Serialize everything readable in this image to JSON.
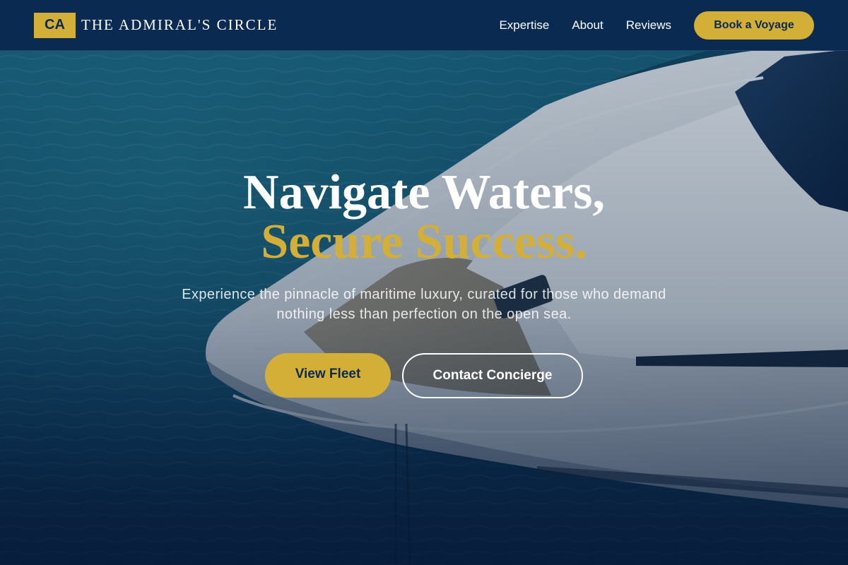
{
  "brand": {
    "logo_mark": "CA",
    "name": "THE ADMIRAL'S CIRCLE"
  },
  "nav": {
    "links": [
      "Expertise",
      "About",
      "Reviews"
    ],
    "cta": "Book a Voyage"
  },
  "hero": {
    "headline_line1": "Navigate Waters,",
    "headline_line2": "Secure Success.",
    "subtext_line1": "Experience the pinnacle of maritime luxury, curated for those who demand",
    "subtext_line2": "nothing less than perfection on the open sea.",
    "primary_button": "View Fleet",
    "secondary_button": "Contact Concierge",
    "background_image": "luxury-yacht-aerial-photo"
  },
  "colors": {
    "navy": "#0a2a52",
    "gold": "#d4af37",
    "white": "#ffffff"
  }
}
